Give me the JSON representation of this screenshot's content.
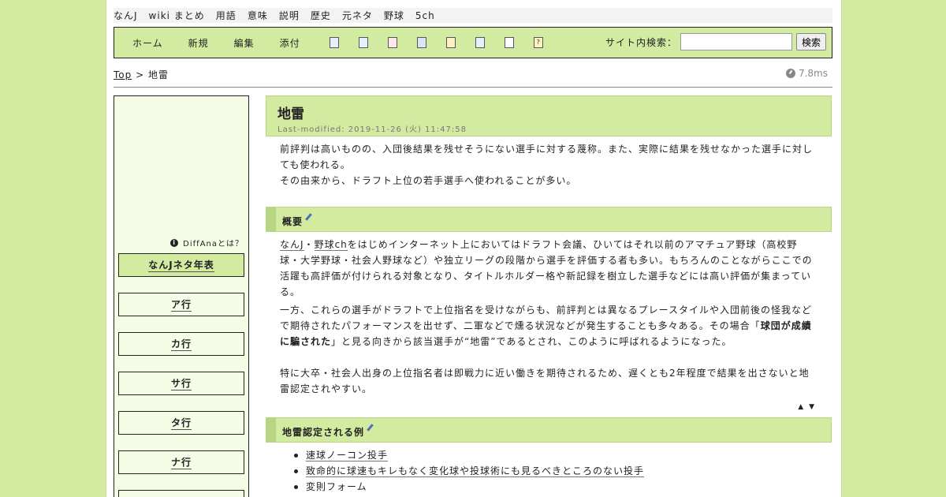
{
  "topnav": [
    "なんJ",
    "wiki まとめ",
    "用語",
    "意味",
    "説明",
    "歴史",
    "元ネタ",
    "野球",
    "5ch"
  ],
  "toolbar": {
    "links": [
      "ホーム",
      "新規",
      "編集",
      "添付"
    ],
    "icons": [
      "copy-icon",
      "diff-icon",
      "delete-icon",
      "save-icon",
      "lock-icon",
      "list-icon",
      "document-icon",
      "help-icon"
    ],
    "search_label": "サイト内検索：",
    "search_placeholder": "",
    "search_button": "検索"
  },
  "breadcrumb": {
    "top": "Top",
    "sep": ">",
    "current": "地雷"
  },
  "timing": "7.8ms",
  "sidebar": {
    "diffana": "DiffAnaとは？",
    "buttons": [
      "なんJネタ年表",
      "ア行",
      "カ行",
      "サ行",
      "タ行",
      "ナ行"
    ]
  },
  "article": {
    "title": "地雷",
    "last_modified": "Last-modified: 2019-11-26 (火) 11:47:58",
    "intro_1": "前評判は高いものの、入団後結果を残せそうにない選手に対する蔑称。また、実際に結果を残せなかった選手に対しても使われる。",
    "intro_2": "その由来から、ドラフト上位の若手選手へ使われることが多い。",
    "section1_title": "概要",
    "s1_p1_link1": "なんJ",
    "s1_p1_sep": "・",
    "s1_p1_link2": "野球ch",
    "s1_p1_rest": "をはじめインターネット上においてはドラフト会議、ひいてはそれ以前のアマチュア野球（高校野球・大学野球・社会人野球など）や独立リーグの段階から選手を評価する者も多い。もちろんのことながらここでの活躍も高評価が付けられる対象となり、タイトルホルダー格や新記録を樹立した選手などには高い評価が集まっている。",
    "s1_p2_a": "一方、これらの選手がドラフトで上位指名を受けながらも、前評判とは異なるプレースタイルや入団前後の怪我などで期待されたパフォーマンスを出せず、二軍などで燻る状況などが発生することも多々ある。その場合「",
    "s1_p2_bold": "球団が成績に騙された",
    "s1_p2_b": "」と見る向きから該当選手が“地雷”であるとされ、このように呼ばれるようになった。",
    "s1_p3": "特に大卒・社会人出身の上位指名者は即戦力に近い働きを期待されるため、遅くとも2年程度で結果を出さないと地雷認定されやすい。",
    "updown": "▲ ▼",
    "section2_title": "地雷認定される例",
    "examples": [
      {
        "text": "速球ノーコン投手",
        "linked": true
      },
      {
        "text": "致命的に球速もキレもなく変化球や投球術にも見るべきところのない投手",
        "linked": true
      },
      {
        "text": "変則フォーム",
        "linked": false
      }
    ]
  }
}
